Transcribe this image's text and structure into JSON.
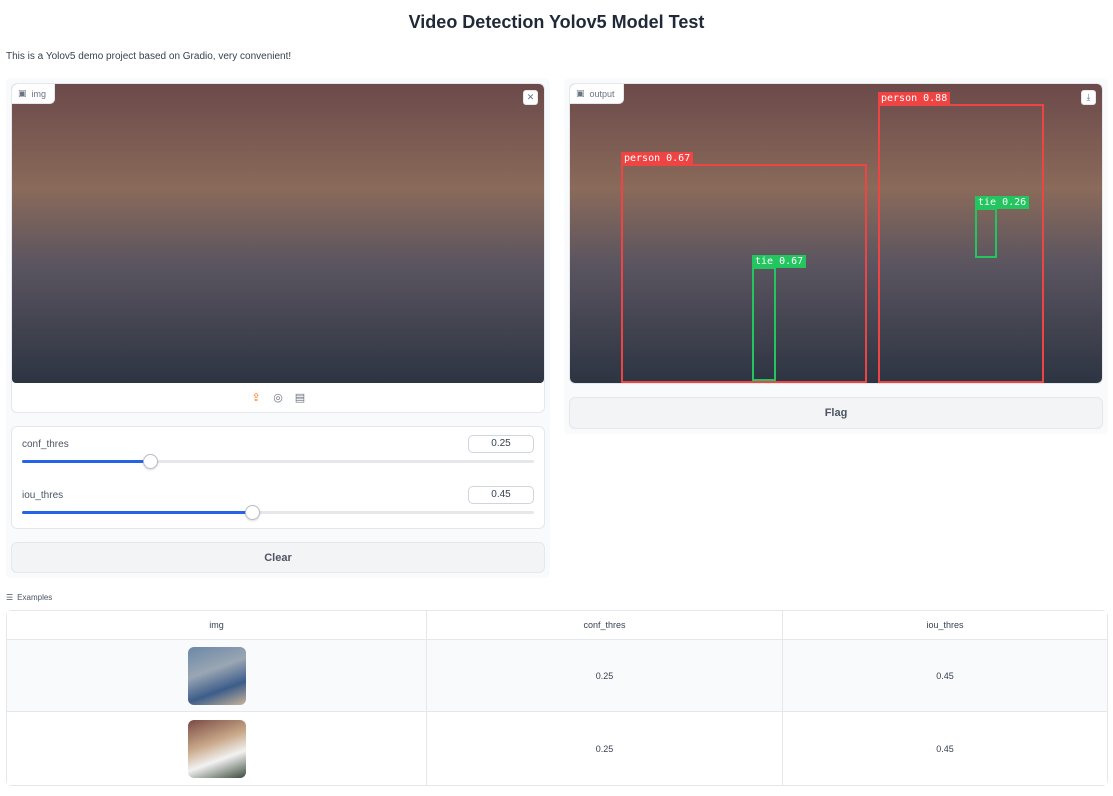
{
  "page": {
    "title": "Video Detection Yolov5 Model Test",
    "description": "This is a Yolov5 demo project based on Gradio, very convenient!"
  },
  "input_image": {
    "label": "img",
    "source_icons": [
      "upload-icon",
      "webcam-icon",
      "clipboard-icon"
    ],
    "clear_icon": "close-icon"
  },
  "output_image": {
    "label": "output",
    "download_icon": "download-icon",
    "detections": [
      {
        "label": "person 0.67",
        "color": "#ef4444"
      },
      {
        "label": "person 0.88",
        "color": "#ef4444"
      },
      {
        "label": "tie 0.67",
        "color": "#22c55e"
      },
      {
        "label": "tie 0.26",
        "color": "#22c55e"
      }
    ]
  },
  "sliders": [
    {
      "label": "conf_thres",
      "value": "0.25",
      "fraction": 0.25
    },
    {
      "label": "iou_thres",
      "value": "0.45",
      "fraction": 0.45
    }
  ],
  "buttons": {
    "clear": "Clear",
    "flag": "Flag"
  },
  "examples": {
    "label": "Examples",
    "headers": [
      "img",
      "conf_thres",
      "iou_thres"
    ],
    "rows": [
      {
        "conf": "0.25",
        "iou": "0.45"
      },
      {
        "conf": "0.25",
        "iou": "0.45"
      }
    ]
  },
  "colors": {
    "accent": "#2563eb",
    "upload_icon": "#f97316",
    "box_person": "#ef4444",
    "box_tie": "#22c55e"
  }
}
